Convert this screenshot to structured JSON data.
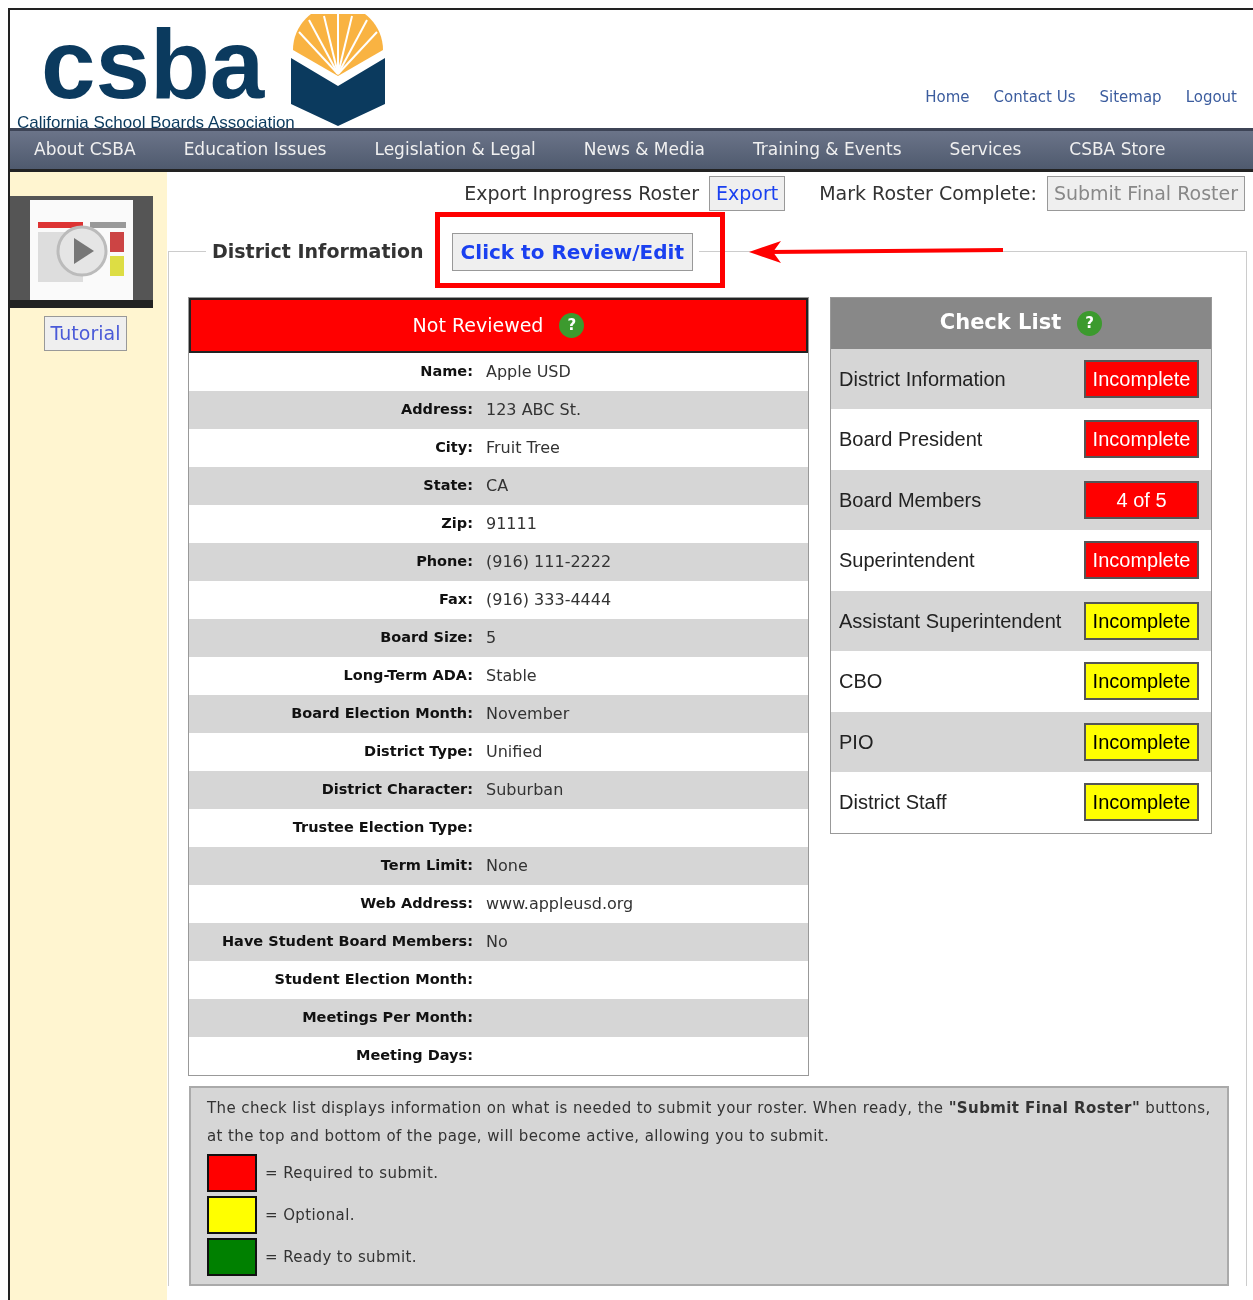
{
  "header": {
    "logo": {
      "name": "csba",
      "tagline": "California School Boards Association"
    },
    "links": [
      "Home",
      "Contact Us",
      "Sitemap",
      "Logout"
    ]
  },
  "nav": [
    "About CSBA",
    "Education Issues",
    "Legislation & Legal",
    "News & Media",
    "Training & Events",
    "Services",
    "CSBA Store"
  ],
  "sidebar": {
    "tutorial": {
      "kind": "picture",
      "button": "Tutorial"
    }
  },
  "toolbar": {
    "export_label": "Export Inprogress Roster",
    "export_button": "Export",
    "complete_label": "Mark Roster Complete:",
    "submit_button": {
      "label": "Submit Final Roster",
      "disabled": true
    }
  },
  "section": {
    "title": "District Information",
    "review_button": "Click to Review/Edit",
    "highlighted": true
  },
  "status": {
    "label": "Not Reviewed",
    "help": "?"
  },
  "fields": [
    {
      "label": "Name:",
      "value": "Apple USD"
    },
    {
      "label": "Address:",
      "value": "123 ABC St."
    },
    {
      "label": "City:",
      "value": "Fruit Tree"
    },
    {
      "label": "State:",
      "value": "CA"
    },
    {
      "label": "Zip:",
      "value": "91111"
    },
    {
      "label": "Phone:",
      "value": "(916) 111-2222"
    },
    {
      "label": "Fax:",
      "value": "(916) 333-4444"
    },
    {
      "label": "Board Size:",
      "value": "5"
    },
    {
      "label": "Long-Term ADA:",
      "value": "Stable"
    },
    {
      "label": "Board Election Month:",
      "value": "November"
    },
    {
      "label": "District Type:",
      "value": "Unified"
    },
    {
      "label": "District Character:",
      "value": "Suburban"
    },
    {
      "label": "Trustee Election Type:"
    },
    {
      "label": "Term Limit:",
      "value": "None"
    },
    {
      "label": "Web Address:",
      "value": "www.appleusd.org"
    },
    {
      "label": "Have Student Board Members:",
      "value": "No"
    },
    {
      "label": "Student Election Month:"
    },
    {
      "label": "Meetings Per Month:"
    },
    {
      "label": "Meeting Days:"
    }
  ],
  "checklist": {
    "title": "Check List",
    "help": "?",
    "items": [
      {
        "label": "District Information",
        "status": "Incomplete",
        "color": "#ff0000"
      },
      {
        "label": "Board President",
        "status": "Incomplete",
        "color": "#ff0000"
      },
      {
        "label": "Board Members",
        "status": "4 of 5",
        "color": "#ff0000"
      },
      {
        "label": "Superintendent",
        "status": "Incomplete",
        "color": "#ff0000"
      },
      {
        "label": "Assistant Superintendent",
        "status": "Incomplete",
        "color": "#ffff00"
      },
      {
        "label": "CBO",
        "status": "Incomplete",
        "color": "#ffff00"
      },
      {
        "label": "PIO",
        "status": "Incomplete",
        "color": "#ffff00"
      },
      {
        "label": "District Staff",
        "status": "Incomplete",
        "color": "#ffff00"
      }
    ]
  },
  "legend": {
    "text": "The check list displays information on what is needed to submit your roster. When ready, the **\"Submit Final Roster\"** buttons, at the top and bottom of the page, will become active, allowing you to submit.",
    "items": [
      {
        "color": "#ff0000",
        "label": "= Required to submit."
      },
      {
        "color": "#ffff00",
        "label": "= Optional."
      },
      {
        "color": "#008000",
        "label": "= Ready to submit."
      }
    ]
  }
}
